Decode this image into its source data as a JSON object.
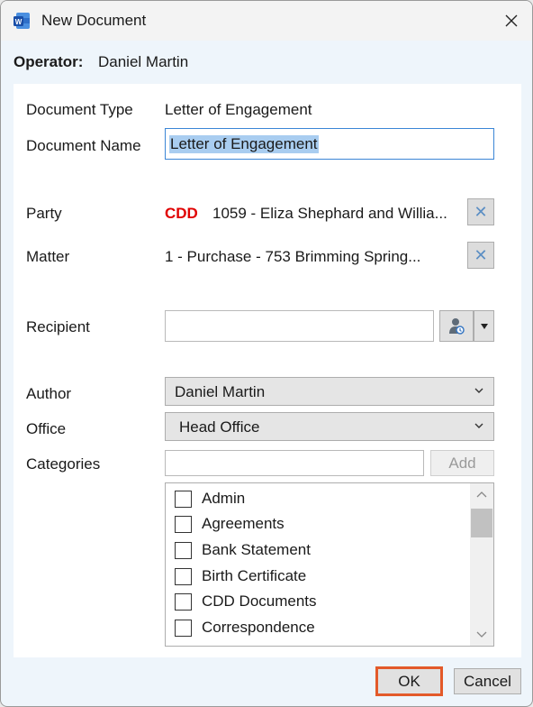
{
  "window": {
    "title": "New Document",
    "app_icon": "word-icon"
  },
  "operator": {
    "label": "Operator:",
    "value": "Daniel Martin"
  },
  "form": {
    "document_type": {
      "label": "Document Type",
      "value": "Letter of Engagement"
    },
    "document_name": {
      "label": "Document Name",
      "value": "Letter of Engagement"
    },
    "party": {
      "label": "Party",
      "badge": "CDD",
      "badge_color": "#e00000",
      "value": "1059 - Eliza Shephard and Willia..."
    },
    "matter": {
      "label": "Matter",
      "value": "1 - Purchase - 753 Brimming Spring..."
    },
    "recipient": {
      "label": "Recipient",
      "value": "",
      "lookup_icon": "user-lookup-icon"
    },
    "author": {
      "label": "Author",
      "selected": "Daniel Martin"
    },
    "office": {
      "label": "Office",
      "selected": "Head Office"
    },
    "categories": {
      "label": "Categories",
      "input_value": "",
      "add_label": "Add",
      "items": [
        {
          "label": "Admin",
          "checked": false
        },
        {
          "label": "Agreements",
          "checked": false
        },
        {
          "label": "Bank Statement",
          "checked": false
        },
        {
          "label": "Birth Certificate",
          "checked": false
        },
        {
          "label": "CDD Documents",
          "checked": false
        },
        {
          "label": "Correspondence",
          "checked": false
        }
      ]
    }
  },
  "buttons": {
    "ok": "OK",
    "cancel": "Cancel"
  },
  "colors": {
    "ok_highlight": "#e35a2a",
    "focus_border": "#3b86d6"
  }
}
